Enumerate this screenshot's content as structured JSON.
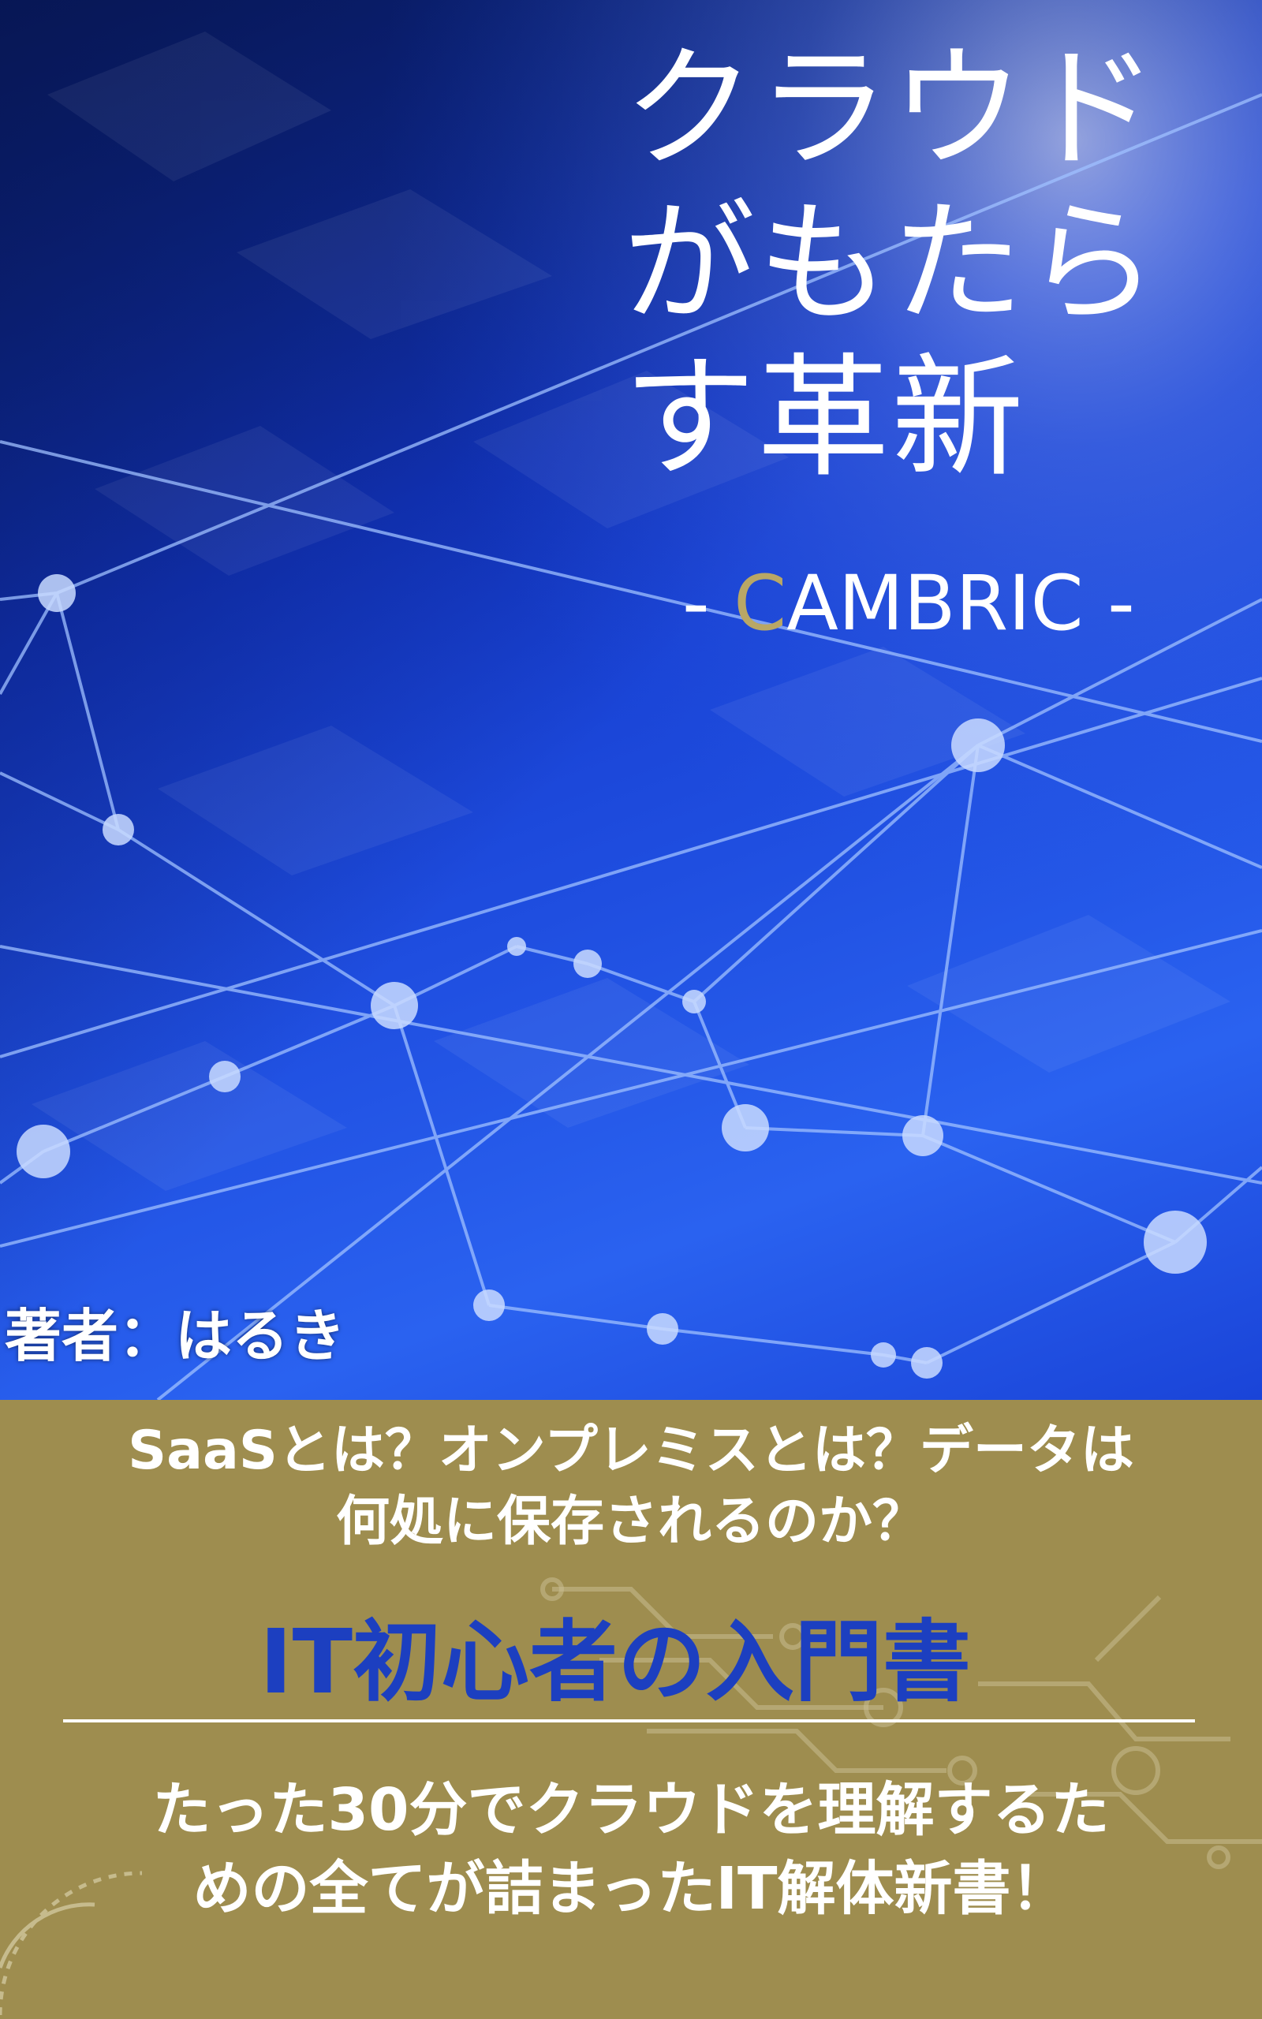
{
  "cover": {
    "title_lines": [
      "クラウド",
      "がもたら",
      "す革新"
    ],
    "brand": {
      "prefix": "- ",
      "accent_letter": "C",
      "rest": "AMBRIC -"
    },
    "author": "著者：はるき"
  },
  "band": {
    "question_lines": [
      "SaaSとは？オンプレミスとは？データは",
      "何処に保存されるのか？"
    ],
    "category": "IT初心者の入門書",
    "pitch_lines": [
      "たった30分でクラウドを理解するた",
      "めの全てが詰まったIT解体新書！"
    ]
  },
  "colors": {
    "band": "#9e8d4f",
    "accent_gold": "#b9a765",
    "category_blue": "#1c3fc0",
    "cover_blue": "#1f4ee0"
  }
}
